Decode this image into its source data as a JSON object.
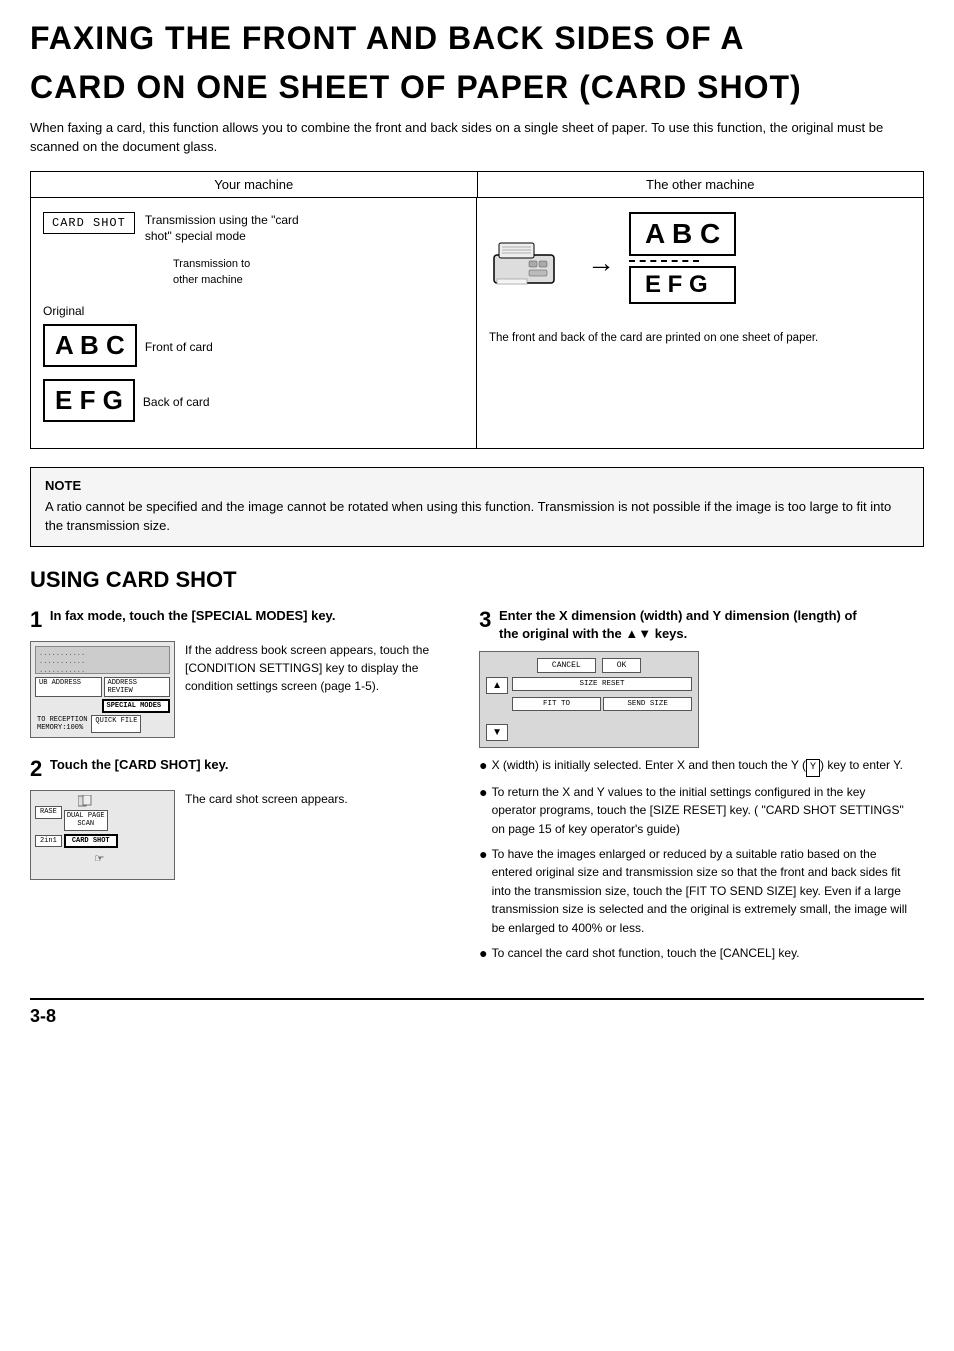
{
  "title": {
    "line1": "FAXING  THE  FRONT  AND  BACK  SIDES  OF  A",
    "line2": "CARD ON ONE SHEET OF PAPER (CARD SHOT)"
  },
  "intro": "When faxing a card, this function allows you to combine the front and back sides on a single sheet of paper. To use this function, the original must be scanned on the document glass.",
  "diagram": {
    "header_left": "Your machine",
    "header_right": "The other machine",
    "card_shot_label": "CARD  SHOT",
    "transmission_label": "Transmission using the \"card shot\" special mode",
    "transmission_other": "Transmission to\nother machine",
    "original_label": "Original",
    "front_label": "Front of card",
    "back_label": "Back of card",
    "abc_text": "A B C",
    "efg_text": "E F G",
    "right_note": "The front and back of the card are printed on one sheet of paper."
  },
  "note": {
    "title": "NOTE",
    "text": "A ratio cannot be specified and the image cannot be rotated when using this function. Transmission is not possible if the image is too large to fit into the transmission size."
  },
  "section_title": "USING CARD SHOT",
  "steps": {
    "step1": {
      "number": "1",
      "title": "In fax mode, touch the [SPECIAL MODES] key.",
      "desc": "If the address book screen appears, touch the [CONDITION SETTINGS] key to display the condition settings screen (page 1-5).",
      "screen_btns": [
        "ADDRESS REVIEW",
        "SPECIAL MODES",
        "QUICK FILE"
      ],
      "screen_labels": [
        "UB ADDRESS",
        "TO RECEPTION",
        "MEMORY:100%"
      ]
    },
    "step2": {
      "number": "2",
      "title": "Touch the [CARD SHOT] key.",
      "desc": "The card shot screen appears.",
      "screen_btns": [
        "DUAL PAGE\nSCAN",
        "CARD SHOT"
      ],
      "screen_labels": [
        "RASE",
        "2in1"
      ]
    },
    "step3": {
      "number": "3",
      "title": "Enter the X dimension (width) and Y dimension (length) of the original with the ▲▼ keys.",
      "btn_cancel": "CANCEL",
      "btn_ok": "OK",
      "btn_up": "▲",
      "btn_down": "▼",
      "btn_size_reset": "SIZE RESET",
      "btn_fit_to": "FIT TO",
      "btn_send_size": "SEND SIZE"
    },
    "bullets": [
      "X (width) is initially selected. Enter X and then touch the Y (  Y  ) key to enter Y.",
      "To return the X and Y values to the initial settings configured in the key operator programs, touch the [SIZE RESET] key. ( \"CARD SHOT SETTINGS\" on page 15 of key operator's guide)",
      "To have the images enlarged or reduced by a suitable ratio based on the entered original size and transmission size so that the front and back sides fit into the transmission size, touch the [FIT TO SEND SIZE] key. Even if a large transmission size is selected and the original is extremely small, the image will be enlarged to 400% or less.",
      "To cancel the card shot function, touch the [CANCEL] key."
    ]
  },
  "page_number": "3-8"
}
